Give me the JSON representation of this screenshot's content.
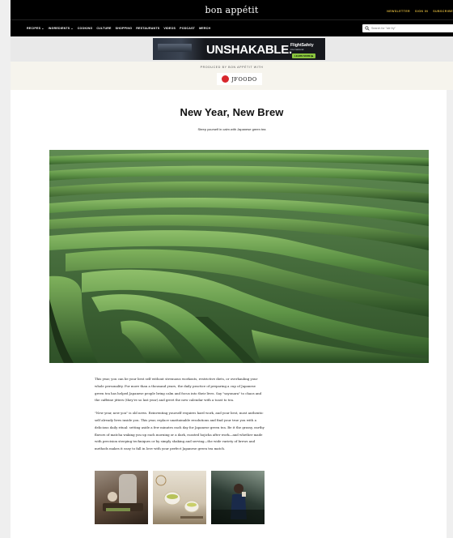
{
  "site": {
    "logo": "bon appétit",
    "top_links": [
      "NEWSLETTER",
      "SIGN IN",
      "SUBSCRIBE"
    ]
  },
  "nav": {
    "items": [
      "RECIPES ⌄",
      "INGREDIENTS ⌄",
      "COOKING",
      "CULTURE",
      "SHOPPING",
      "RESTAURANTS",
      "VIDEOS",
      "PODCAST",
      "MERCH"
    ],
    "search_placeholder": "Search for \"stir fry\""
  },
  "ad": {
    "headline": "UNSHAKABLE.",
    "brand": "FlightSafety",
    "brand_sub": "international",
    "cta": "LEARN MORE ▶"
  },
  "sponsor": {
    "produced_by": "PRODUCED BY BON APPÉTIT WITH",
    "partner": "JFOODO"
  },
  "article": {
    "title": "New Year, New Brew",
    "dek": "Steep yourself in calm with Japanese green tea",
    "paragraphs": [
      "This year, you can be your best self without strenuous workouts, restrictive diets, or overhauling your whole personality. For more than a thousand years, the daily practice of preparing a cup of Japanese green tea has helped Japanese people bring calm and focus into their lives. Say \"sayonara\" to chaos and the caffeine jitters (they're so last year) and greet the new calendar with a toast to tea.",
      "\"New year, new you\" is old news. Reinventing yourself requires hard work, and your best, most authentic self already lives inside you. This year, replace unattainable resolutions and find your true you with a delicious daily ritual: setting aside a few minutes each day for Japanese green tea. Be it the grassy, earthy flavors of matcha waking you up each morning or a dark, roasted hojicha after work—and whether made with precision steeping techniques or by simply shaking and serving—the wide variety of brews and methods makes it easy to fall in love with your perfect Japanese green tea match."
    ]
  },
  "colors": {
    "accent": "#d7b23b",
    "jfoodo_red": "#d8272c",
    "cta_green": "#8ac43f"
  }
}
